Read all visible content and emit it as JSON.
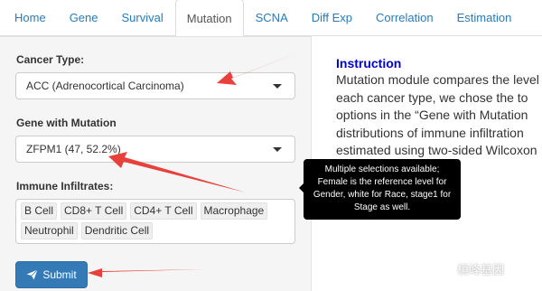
{
  "nav": {
    "tabs": [
      {
        "label": "Home"
      },
      {
        "label": "Gene"
      },
      {
        "label": "Survival"
      },
      {
        "label": "Mutation",
        "active": true
      },
      {
        "label": "SCNA"
      },
      {
        "label": "Diff Exp"
      },
      {
        "label": "Correlation"
      },
      {
        "label": "Estimation"
      }
    ]
  },
  "sidebar": {
    "cancer_type": {
      "label": "Cancer Type:",
      "value": "ACC (Adrenocortical Carcinoma)"
    },
    "gene": {
      "label": "Gene with Mutation",
      "value": "ZFPM1 (47, 52.2%)"
    },
    "infiltrates": {
      "label": "Immune Infiltrates:",
      "selected": [
        "B Cell",
        "CD8+ T Cell",
        "CD4+ T Cell",
        "Macrophage",
        "Neutrophil",
        "Dendritic Cell"
      ]
    },
    "submit_label": "Submit"
  },
  "main": {
    "title": "Instruction",
    "lines": [
      "Mutation module compares the level",
      "each cancer type, we chose the to",
      "options in the “Gene with Mutation",
      "distributions of immune infiltration",
      "estimated using two-sided Wilcoxon"
    ]
  },
  "tooltip": {
    "lines": [
      "Multiple selections available;",
      "Female is the reference level for",
      "Gender, white for Race, stage1 for",
      "Stage as well."
    ]
  },
  "watermark": "桓峰基因",
  "colors": {
    "link": "#2a7ab8",
    "primary": "#337ab7",
    "title": "#0000cc",
    "arrow": "#e8403a"
  },
  "icons": {
    "submit": "paper-plane-icon",
    "select": "caret-down-icon"
  }
}
